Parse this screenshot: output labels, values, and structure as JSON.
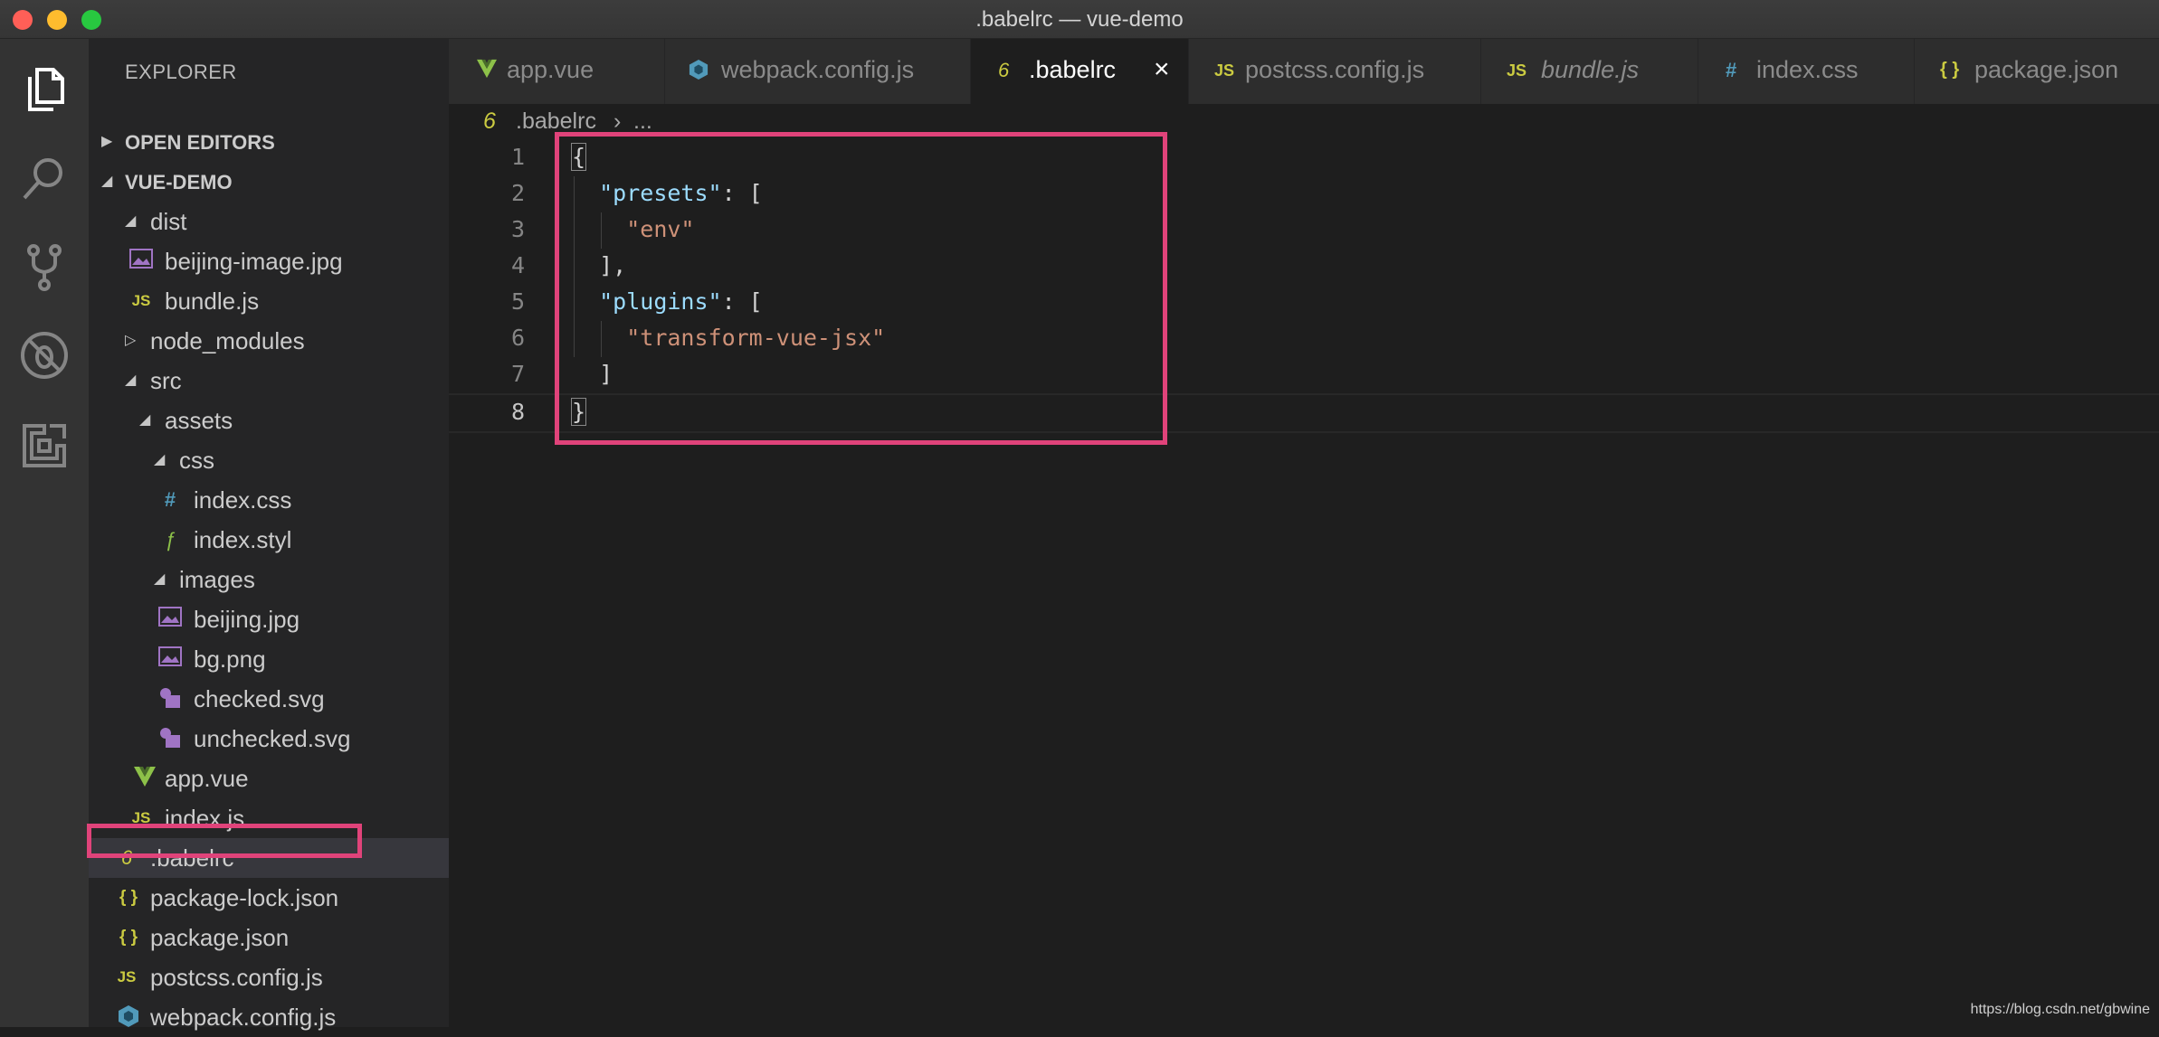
{
  "window": {
    "title": ".babelrc — vue-demo"
  },
  "sidebar": {
    "title": "EXPLORER",
    "sections": {
      "open_editors": "OPEN EDITORS",
      "project": "VUE-DEMO"
    },
    "tree": [
      {
        "label": "dist",
        "kind": "folder-open"
      },
      {
        "label": "beijing-image.jpg",
        "kind": "image"
      },
      {
        "label": "bundle.js",
        "kind": "js"
      },
      {
        "label": "node_modules",
        "kind": "folder-closed"
      },
      {
        "label": "src",
        "kind": "folder-open"
      },
      {
        "label": "assets",
        "kind": "folder-open"
      },
      {
        "label": "css",
        "kind": "folder-open"
      },
      {
        "label": "index.css",
        "kind": "css"
      },
      {
        "label": "index.styl",
        "kind": "stylus"
      },
      {
        "label": "images",
        "kind": "folder-open"
      },
      {
        "label": "beijing.jpg",
        "kind": "image"
      },
      {
        "label": "bg.png",
        "kind": "image"
      },
      {
        "label": "checked.svg",
        "kind": "svg"
      },
      {
        "label": "unchecked.svg",
        "kind": "svg"
      },
      {
        "label": "app.vue",
        "kind": "vue"
      },
      {
        "label": "index.js",
        "kind": "js"
      },
      {
        "label": ".babelrc",
        "kind": "babel",
        "selected": true
      },
      {
        "label": "package-lock.json",
        "kind": "json"
      },
      {
        "label": "package.json",
        "kind": "json"
      },
      {
        "label": "postcss.config.js",
        "kind": "js"
      },
      {
        "label": "webpack.config.js",
        "kind": "webpack"
      }
    ]
  },
  "tabs": [
    {
      "label": "app.vue",
      "kind": "vue"
    },
    {
      "label": "webpack.config.js",
      "kind": "webpack"
    },
    {
      "label": ".babelrc",
      "kind": "babel",
      "active": true,
      "close": "×"
    },
    {
      "label": "postcss.config.js",
      "kind": "js"
    },
    {
      "label": "bundle.js",
      "kind": "js",
      "italic": true
    },
    {
      "label": "index.css",
      "kind": "css"
    },
    {
      "label": "package.json",
      "kind": "json"
    }
  ],
  "breadcrumb": {
    "file": ".babelrc",
    "sep": "›",
    "more": "..."
  },
  "editor": {
    "line_numbers": [
      "1",
      "2",
      "3",
      "4",
      "5",
      "6",
      "7",
      "8"
    ],
    "current_line": "8",
    "tokens": {
      "open_brace": "{",
      "presets_key": "\"presets\"",
      "colon_bracket": ": [",
      "env": "\"env\"",
      "close_bracket_comma": "],",
      "plugins_key": "\"plugins\"",
      "transform": "\"transform-vue-jsx\"",
      "close_bracket": "]",
      "close_brace": "}"
    }
  },
  "icons": {
    "js": "JS",
    "json": "{ }",
    "css": "#",
    "stylus": "ƒ",
    "babel": "6",
    "vue": "vue-logo-icon",
    "webpack": "webpack-cube-icon",
    "image": "image-file-icon",
    "svg": "svg-file-icon"
  },
  "colors": {
    "highlight": "#e0437a",
    "js": "#cbcb41",
    "json": "#cbcb41",
    "css": "#519aba",
    "stylus": "#8dc149",
    "babel": "#cbcb41",
    "vue": "#8dc149",
    "webpack": "#519aba",
    "image": "#a074c4",
    "svg": "#a074c4"
  },
  "watermark": "https://blog.csdn.net/gbwine"
}
